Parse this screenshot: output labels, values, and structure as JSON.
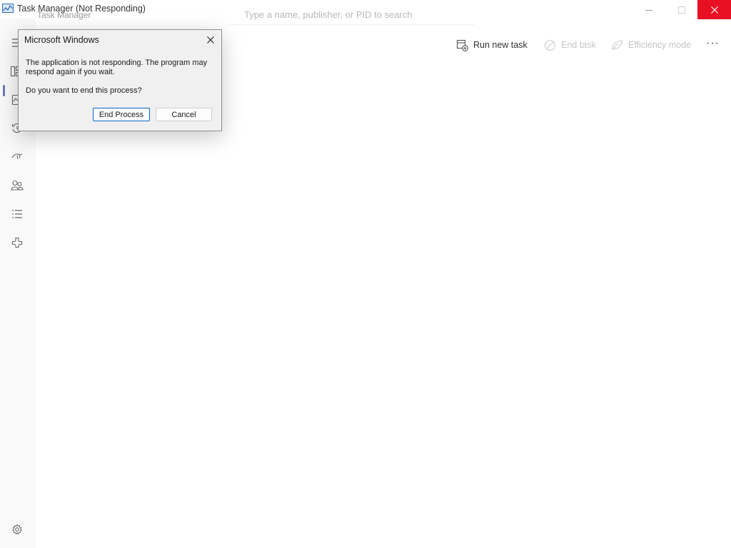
{
  "window": {
    "title": "Task Manager (Not Responding)",
    "app_icon": "task-manager-icon",
    "controls": [
      "minimize-icon",
      "maximize-icon",
      "close-icon"
    ],
    "close_color": "#e81123"
  },
  "background": {
    "app_name": "Task Manager",
    "search_placeholder": "Type a name, publisher, or PID to search"
  },
  "sidebar": {
    "items": [
      {
        "icon": "hamburger-icon"
      },
      {
        "icon": "processes-icon",
        "selected": true
      },
      {
        "icon": "performance-icon"
      },
      {
        "icon": "app-history-icon"
      },
      {
        "icon": "startup-apps-icon"
      },
      {
        "icon": "users-icon"
      },
      {
        "icon": "details-icon"
      },
      {
        "icon": "services-icon"
      }
    ],
    "settings_icon": "settings-icon"
  },
  "toolbar": {
    "run_new_task": "Run new task",
    "end_task": "End task",
    "efficiency_mode": "Efficiency mode",
    "more": "···"
  },
  "dialog": {
    "title": "Microsoft Windows",
    "message": "The application is not responding. The program may respond again if you wait.",
    "question": "Do you want to end this process?",
    "end_process_label": "End Process",
    "cancel_label": "Cancel"
  }
}
